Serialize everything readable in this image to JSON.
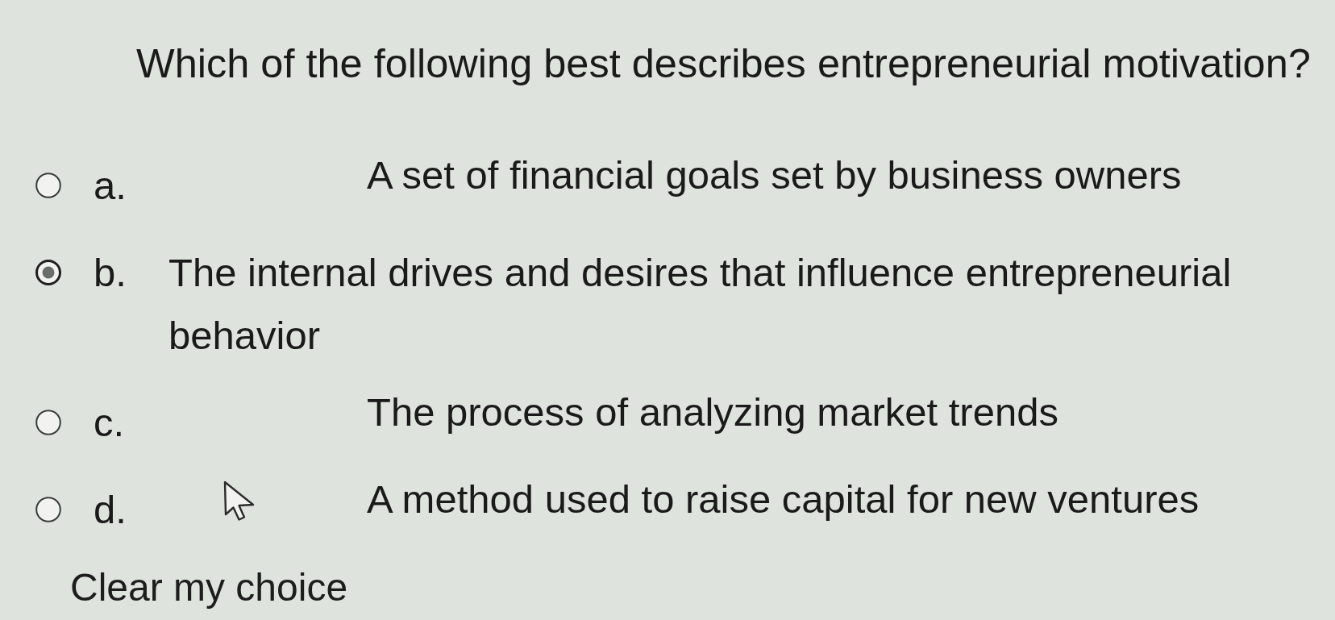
{
  "question": {
    "text": "Which of the following best describes entrepreneurial motivation?"
  },
  "options": [
    {
      "letter": "a.",
      "text": "A set of financial goals set by business owners",
      "selected": false
    },
    {
      "letter": "b.",
      "text": "The internal drives and desires that influence entrepreneurial behavior",
      "selected": true
    },
    {
      "letter": "c.",
      "text": "The process of analyzing market trends",
      "selected": false
    },
    {
      "letter": "d.",
      "text": "A method used to raise capital for new ventures",
      "selected": false
    }
  ],
  "clear_choice": {
    "label": "Clear my choice"
  }
}
